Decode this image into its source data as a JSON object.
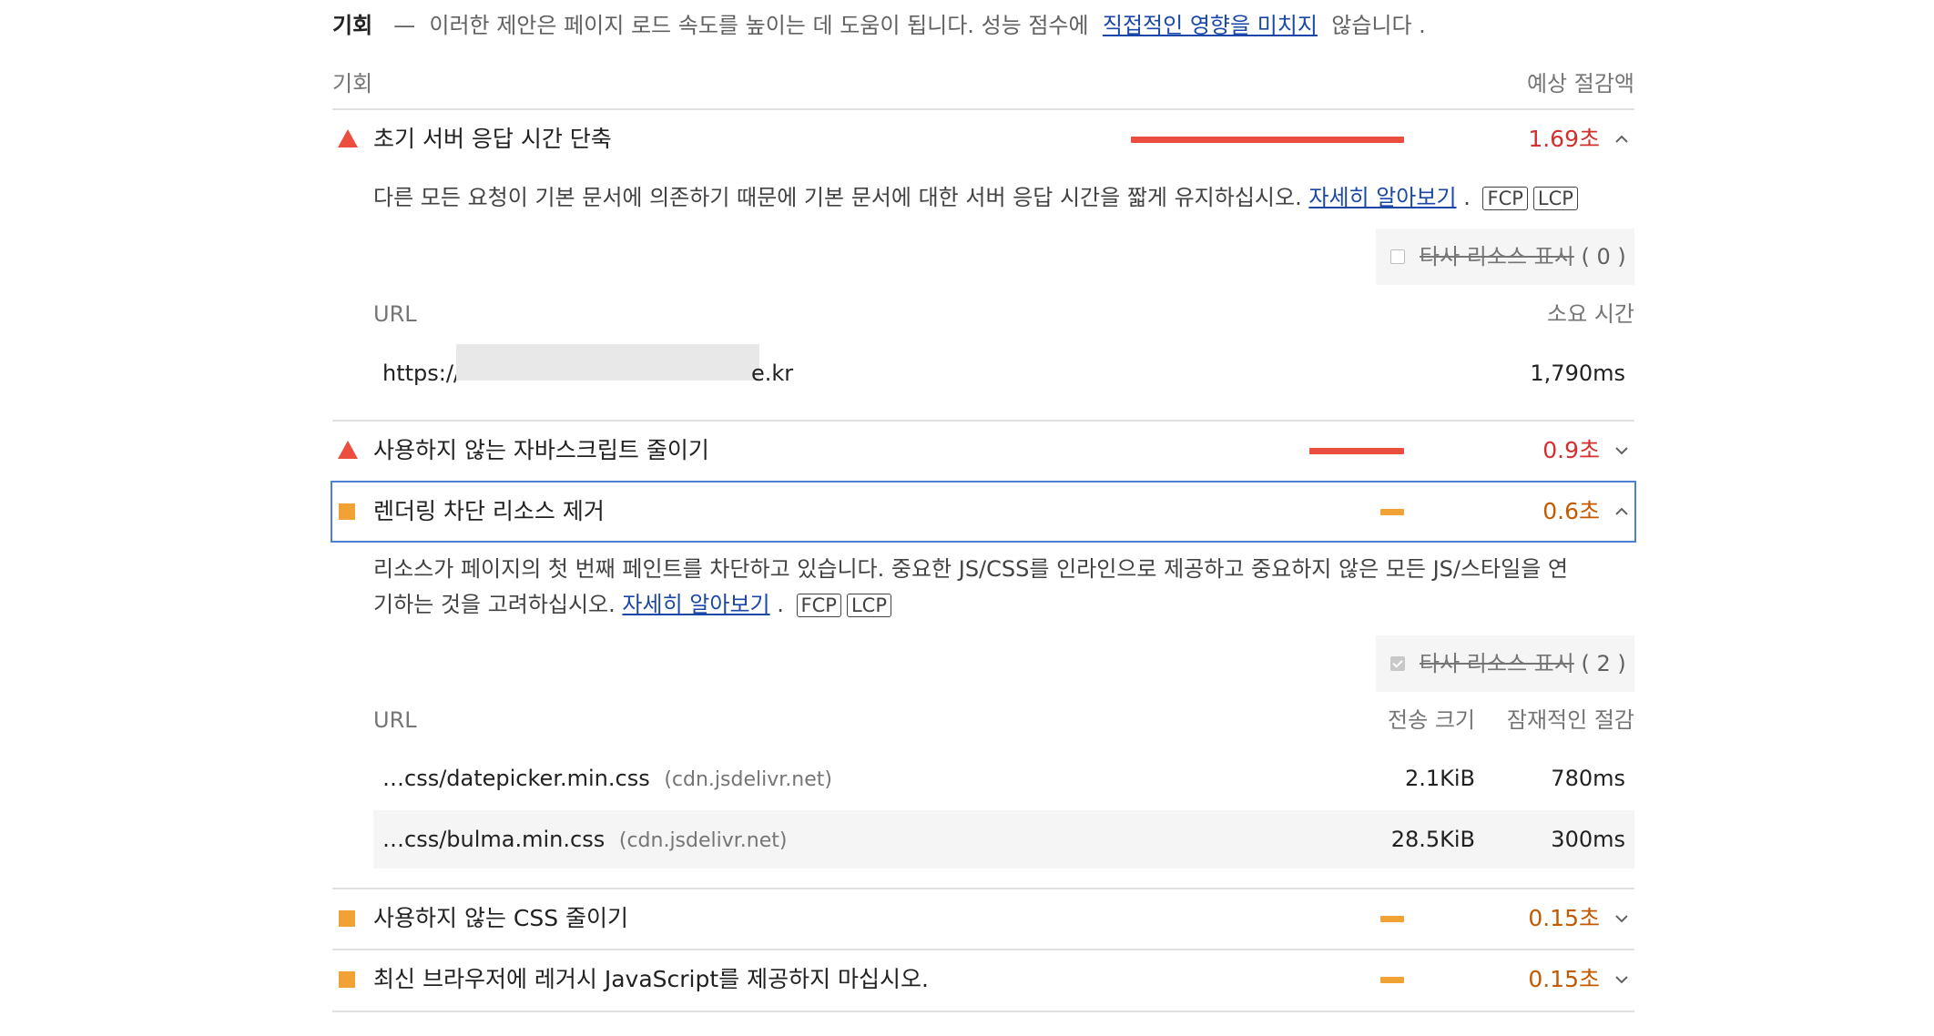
{
  "intro": {
    "title": "기회",
    "dash": "—",
    "text_before": "이러한 제안은 페이지 로드 속도를 높이는 데 도움이 됩니다. 성능 점수에",
    "link": "직접적인 영향을 미치지",
    "text_after": "않습니다 ."
  },
  "column_headers": {
    "left": "기회",
    "right": "예상 절감액"
  },
  "audits": [
    {
      "title": "초기 서버 응답 시간 단축",
      "savings": "1.69초",
      "savings_seconds": 1.69,
      "rating": "fail",
      "expanded": true,
      "description": "다른 모든 요청이 기본 문서에 의존하기 때문에 기본 문서에 대한 서버 응답 시간을 짧게 유지하십시오.",
      "learn_more": "자세히 알아보기",
      "period": ".",
      "tags": [
        "FCP",
        "LCP"
      ],
      "filter_label": "타사 리소스 표시",
      "filter_count": "( 0 )",
      "filter_checked": false,
      "table_headers": [
        "URL",
        "소요 시간"
      ],
      "rows": [
        {
          "url_prefix": "https://t",
          "url_suffix": "e.kr",
          "value": "1,790ms"
        }
      ]
    },
    {
      "title": "사용하지 않는 자바스크립트 줄이기",
      "savings": "0.9초",
      "savings_seconds": 0.9,
      "rating": "fail",
      "expanded": false
    },
    {
      "title": "렌더링 차단 리소스 제거",
      "savings": "0.6초",
      "savings_seconds": 0.6,
      "rating": "average",
      "expanded": true,
      "description_line1": "리소스가 페이지의 첫 번째 페인트를 차단하고 있습니다. 중요한 JS/CSS를 인라인으로 제공하고 중요하지 않은 모든 JS/스타일을 연",
      "description_line2": "기하는 것을 고려하십시오.",
      "learn_more": "자세히 알아보기",
      "period": ".",
      "tags": [
        "FCP",
        "LCP"
      ],
      "filter_label": "타사 리소스 표시",
      "filter_count": "( 2 )",
      "filter_checked": true,
      "table_headers": [
        "URL",
        "전송 크기",
        "잠재적인 절감"
      ],
      "rows": [
        {
          "url": "…css/datepicker.min.css",
          "host": "(cdn.jsdelivr.net)",
          "size": "2.1KiB",
          "savings": "780ms"
        },
        {
          "url": "…css/bulma.min.css",
          "host": "(cdn.jsdelivr.net)",
          "size": "28.5KiB",
          "savings": "300ms"
        }
      ]
    },
    {
      "title": "사용하지 않는 CSS 줄이기",
      "savings": "0.15초",
      "savings_seconds": 0.15,
      "rating": "average",
      "expanded": false
    },
    {
      "title": "최신 브라우저에 레거시 JavaScript를 제공하지 마십시오.",
      "savings": "0.15초",
      "savings_seconds": 0.15,
      "rating": "average",
      "expanded": false
    }
  ],
  "colors": {
    "fail": "#eb4d3f",
    "average": "#f0a234",
    "link": "#1a47a8",
    "focus": "#4a7fd1"
  }
}
